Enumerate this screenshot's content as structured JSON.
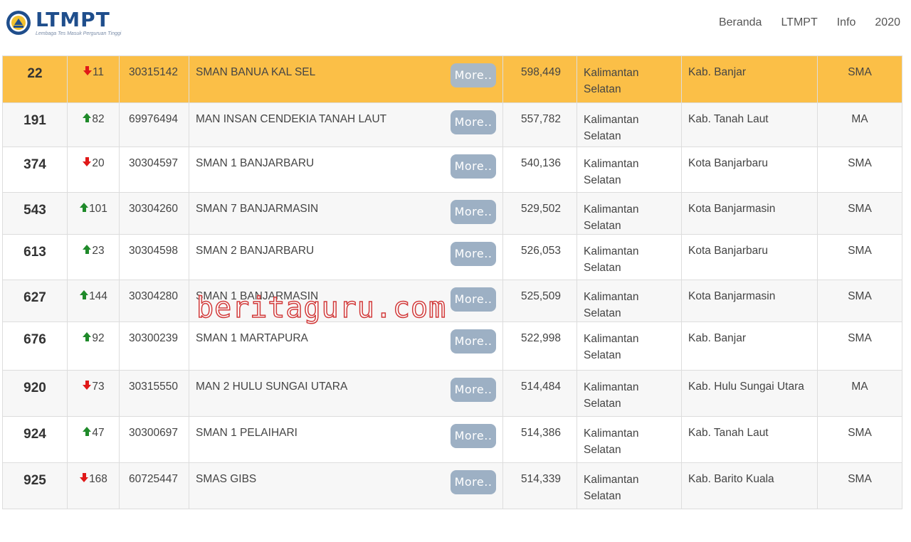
{
  "header": {
    "logo_title": "LTMPT",
    "logo_subtitle": "Lembaga Tes Masuk Perguruan Tinggi",
    "nav": [
      "Beranda",
      "LTMPT",
      "Info",
      "2020"
    ]
  },
  "colors": {
    "highlight_row": "#fbbf47",
    "arrow_up": "#1f8a2a",
    "arrow_down": "#e01818",
    "more_button": "#9db0c4",
    "logo_blue": "#1f4e8c"
  },
  "table": {
    "more_label": "More..",
    "rows": [
      {
        "rank": "22",
        "direction": "down",
        "change": "11",
        "npsn": "30315142",
        "school": "SMAN BANUA KAL SEL",
        "score": "598,449",
        "province_line1": "Kalimantan",
        "province_line2": "Selatan",
        "city": "Kab. Banjar",
        "type": "SMA",
        "highlight": true
      },
      {
        "rank": "191",
        "direction": "up",
        "change": "82",
        "npsn": "69976494",
        "school": "MAN INSAN CENDEKIA TANAH LAUT",
        "score": "557,782",
        "province_line1": "Kalimantan",
        "province_line2": "Selatan",
        "city": "Kab. Tanah Laut",
        "type": "MA"
      },
      {
        "rank": "374",
        "direction": "down",
        "change": "20",
        "npsn": "30304597",
        "school": "SMAN 1 BANJARBARU",
        "score": "540,136",
        "province_line1": "Kalimantan",
        "province_line2": "Selatan",
        "city": "Kota Banjarbaru",
        "type": "SMA"
      },
      {
        "rank": "543",
        "direction": "up",
        "change": "101",
        "npsn": "30304260",
        "school": "SMAN 7 BANJARMASIN",
        "score": "529,502",
        "province_line1": "Kalimantan",
        "province_line2": "Selatan",
        "city": "Kota Banjarmasin",
        "type": "SMA"
      },
      {
        "rank": "613",
        "direction": "up",
        "change": "23",
        "npsn": "30304598",
        "school": "SMAN 2 BANJARBARU",
        "score": "526,053",
        "province_line1": "Kalimantan",
        "province_line2": "Selatan",
        "city": "Kota Banjarbaru",
        "type": "SMA"
      },
      {
        "rank": "627",
        "direction": "up",
        "change": "144",
        "npsn": "30304280",
        "school": "SMAN 1 BANJARMASIN",
        "score": "525,509",
        "province_line1": "Kalimantan",
        "province_line2": "Selatan",
        "city": "Kota Banjarmasin",
        "type": "SMA"
      },
      {
        "rank": "676",
        "direction": "up",
        "change": "92",
        "npsn": "30300239",
        "school": "SMAN 1 MARTAPURA",
        "score": "522,998",
        "province_line1": "Kalimantan",
        "province_line2": "Selatan",
        "city": "Kab. Banjar",
        "type": "SMA"
      },
      {
        "rank": "920",
        "direction": "down",
        "change": "73",
        "npsn": "30315550",
        "school": "MAN 2 HULU SUNGAI UTARA",
        "score": "514,484",
        "province_line1": "Kalimantan",
        "province_line2": "Selatan",
        "city": "Kab. Hulu Sungai Utara",
        "type": "MA"
      },
      {
        "rank": "924",
        "direction": "up",
        "change": "47",
        "npsn": "30300697",
        "school": "SMAN 1 PELAIHARI",
        "score": "514,386",
        "province_line1": "Kalimantan",
        "province_line2": "Selatan",
        "city": "Kab. Tanah Laut",
        "type": "SMA"
      },
      {
        "rank": "925",
        "direction": "down",
        "change": "168",
        "npsn": "60725447",
        "school": "SMAS GIBS",
        "score": "514,339",
        "province_line1": "Kalimantan",
        "province_line2": "Selatan",
        "city": "Kab. Barito Kuala",
        "type": "SMA"
      }
    ]
  },
  "watermark": "beritaguru.com"
}
